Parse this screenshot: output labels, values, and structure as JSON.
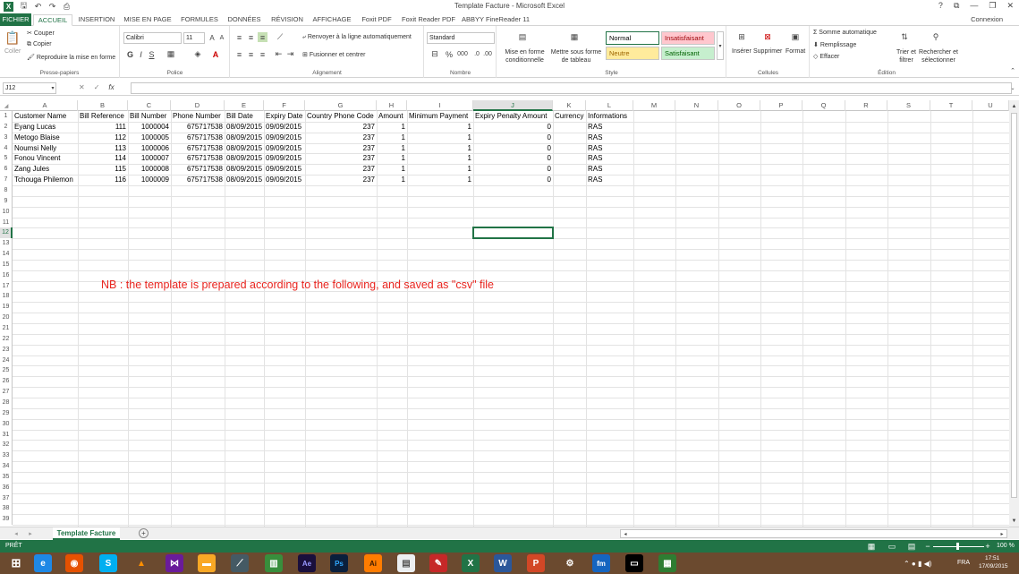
{
  "window": {
    "title": "Template Facture - Microsoft Excel",
    "connexion": "Connexion",
    "help": "?",
    "restore_ribbon": "⧉",
    "minimize": "—",
    "maximize": "❐",
    "close": "✕"
  },
  "tabs": [
    "FICHIER",
    "ACCUEIL",
    "INSERTION",
    "MISE EN PAGE",
    "FORMULES",
    "DONNÉES",
    "RÉVISION",
    "AFFICHAGE",
    "Foxit PDF",
    "Foxit Reader PDF",
    "ABBYY FineReader 11"
  ],
  "ribbon": {
    "clipboard": {
      "paste": "Coller",
      "cut": "Couper",
      "copy": "Copier",
      "format_painter": "Reproduire la mise en forme",
      "label": "Presse-papiers"
    },
    "font": {
      "name": "Calibri",
      "size": "11",
      "label": "Police",
      "bold": "G",
      "italic": "I",
      "underline": "S"
    },
    "alignment": {
      "wrap": "Renvoyer à la ligne automatiquement",
      "merge": "Fusionner et centrer",
      "label": "Alignement"
    },
    "number": {
      "format": "Standard",
      "label": "Nombre",
      "percent": "%",
      "thousands": "000"
    },
    "styles": {
      "conditional": "Mise en forme conditionnelle",
      "table": "Mettre sous forme de tableau",
      "normal": "Normal",
      "bad": "Insatisfaisant",
      "neutral": "Neutre",
      "good": "Satisfaisant",
      "label": "Style"
    },
    "cells": {
      "insert": "Insérer",
      "delete": "Supprimer",
      "format": "Format",
      "label": "Cellules"
    },
    "editing": {
      "autosum": "Somme automatique",
      "fill": "Remplissage",
      "clear": "Effacer",
      "sort": "Trier et filtrer",
      "find": "Rechercher et sélectionner",
      "label": "Édition"
    }
  },
  "formula_bar": {
    "name_box": "J12",
    "value": "",
    "fx": "fx"
  },
  "columns": [
    "A",
    "B",
    "C",
    "D",
    "E",
    "F",
    "G",
    "H",
    "I",
    "J",
    "K",
    "L",
    "M",
    "N",
    "O",
    "P",
    "Q",
    "R",
    "S",
    "T",
    "U"
  ],
  "rows": [
    "1",
    "2",
    "3",
    "4",
    "5",
    "6",
    "7",
    "8",
    "9",
    "10",
    "11",
    "12",
    "13",
    "14",
    "15",
    "16",
    "17",
    "18",
    "19",
    "20",
    "21",
    "22",
    "23",
    "24",
    "25",
    "26",
    "27",
    "28",
    "29",
    "30",
    "31",
    "32",
    "33",
    "34",
    "35",
    "36",
    "37",
    "38",
    "39"
  ],
  "headers": [
    "Customer Name",
    "Bill Reference",
    "Bill Number",
    "Phone Number",
    "Bill Date",
    "Expiry Date",
    "Country Phone Code",
    "Amount",
    "Minimum Payment",
    "Expiry Penalty Amount",
    "Currency",
    "Informations"
  ],
  "data": [
    [
      "Eyang Lucas",
      "111",
      "1000004",
      "675717538",
      "08/09/2015",
      "09/09/2015",
      "237",
      "1",
      "1",
      "0",
      "",
      "RAS"
    ],
    [
      "Metogo Blaise",
      "112",
      "1000005",
      "675717538",
      "08/09/2015",
      "09/09/2015",
      "237",
      "1",
      "1",
      "0",
      "",
      "RAS"
    ],
    [
      "Noumsi Nelly",
      "113",
      "1000006",
      "675717538",
      "08/09/2015",
      "09/09/2015",
      "237",
      "1",
      "1",
      "0",
      "",
      "RAS"
    ],
    [
      "Fonou Vincent",
      "114",
      "1000007",
      "675717538",
      "08/09/2015",
      "09/09/2015",
      "237",
      "1",
      "1",
      "0",
      "",
      "RAS"
    ],
    [
      "Zang Jules",
      "115",
      "1000008",
      "675717538",
      "08/09/2015",
      "09/09/2015",
      "237",
      "1",
      "1",
      "0",
      "",
      "RAS"
    ],
    [
      "Tchouga Philemon",
      "116",
      "1000009",
      "675717538",
      "08/09/2015",
      "09/09/2015",
      "237",
      "1",
      "1",
      "0",
      "",
      "RAS"
    ]
  ],
  "note": "NB : the template is prepared according to the following, and saved as \"csv\" file",
  "sheet_tab": "Template Facture",
  "status": {
    "ready": "PRÊT",
    "zoom": "100 %"
  },
  "taskbar": {
    "lang": "FRA",
    "time": "17:51",
    "date": "17/09/2015"
  },
  "colors": {
    "accent": "#217346",
    "note": "#e8251f"
  }
}
